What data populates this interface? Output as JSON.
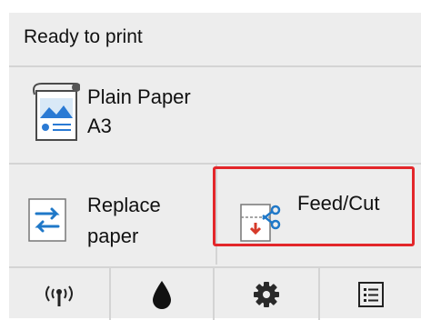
{
  "status": {
    "text": "Ready to print"
  },
  "paper": {
    "type": "Plain Paper",
    "size": "A3",
    "icon": "paper-roll-icon"
  },
  "buttons": {
    "replace": {
      "line1": "Replace",
      "line2": "paper",
      "icon": "replace-paper-icon"
    },
    "feed": {
      "label": "Feed/Cut",
      "icon": "feed-cut-icon",
      "highlighted": true
    }
  },
  "toolbar": [
    {
      "icon": "wireless-icon"
    },
    {
      "icon": "ink-drop-icon"
    },
    {
      "icon": "gear-icon"
    },
    {
      "icon": "list-icon"
    }
  ],
  "colors": {
    "highlight": "#e3262a",
    "panel": "#ededed",
    "divider": "#d4d4d4",
    "accent_blue": "#1f78c8"
  }
}
